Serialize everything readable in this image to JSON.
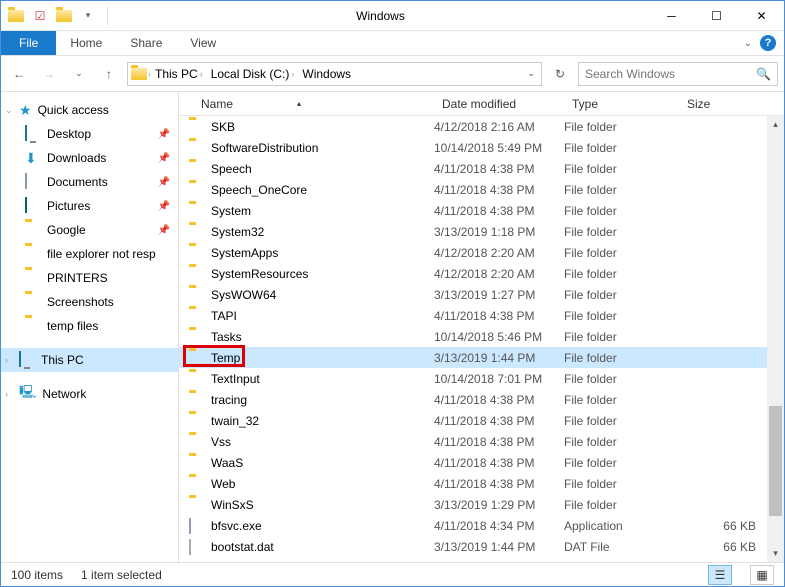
{
  "window": {
    "title": "Windows"
  },
  "ribbon": {
    "file": "File",
    "tabs": [
      "Home",
      "Share",
      "View"
    ]
  },
  "breadcrumb": {
    "segments": [
      "This PC",
      "Local Disk (C:)",
      "Windows"
    ]
  },
  "search": {
    "placeholder": "Search Windows"
  },
  "sidebar": {
    "quick_access": "Quick access",
    "items": [
      {
        "label": "Desktop",
        "icon": "desktop",
        "pinned": true
      },
      {
        "label": "Downloads",
        "icon": "downloads",
        "pinned": true
      },
      {
        "label": "Documents",
        "icon": "documents",
        "pinned": true
      },
      {
        "label": "Pictures",
        "icon": "pictures",
        "pinned": true
      },
      {
        "label": "Google",
        "icon": "folder",
        "pinned": true
      },
      {
        "label": "file explorer not resp",
        "icon": "folder",
        "pinned": false
      },
      {
        "label": "PRINTERS",
        "icon": "folder",
        "pinned": false
      },
      {
        "label": "Screenshots",
        "icon": "folder",
        "pinned": false
      },
      {
        "label": "temp files",
        "icon": "folder",
        "pinned": false
      }
    ],
    "this_pc": "This PC",
    "network": "Network"
  },
  "columns": {
    "name": "Name",
    "date": "Date modified",
    "type": "Type",
    "size": "Size"
  },
  "files": [
    {
      "name": "SKB",
      "date": "4/12/2018 2:16 AM",
      "type": "File folder",
      "icon": "folder",
      "size": ""
    },
    {
      "name": "SoftwareDistribution",
      "date": "10/14/2018 5:49 PM",
      "type": "File folder",
      "icon": "folder",
      "size": ""
    },
    {
      "name": "Speech",
      "date": "4/11/2018 4:38 PM",
      "type": "File folder",
      "icon": "folder",
      "size": ""
    },
    {
      "name": "Speech_OneCore",
      "date": "4/11/2018 4:38 PM",
      "type": "File folder",
      "icon": "folder",
      "size": ""
    },
    {
      "name": "System",
      "date": "4/11/2018 4:38 PM",
      "type": "File folder",
      "icon": "folder",
      "size": ""
    },
    {
      "name": "System32",
      "date": "3/13/2019 1:18 PM",
      "type": "File folder",
      "icon": "folder",
      "size": ""
    },
    {
      "name": "SystemApps",
      "date": "4/12/2018 2:20 AM",
      "type": "File folder",
      "icon": "folder",
      "size": ""
    },
    {
      "name": "SystemResources",
      "date": "4/12/2018 2:20 AM",
      "type": "File folder",
      "icon": "folder",
      "size": ""
    },
    {
      "name": "SysWOW64",
      "date": "3/13/2019 1:27 PM",
      "type": "File folder",
      "icon": "folder",
      "size": ""
    },
    {
      "name": "TAPI",
      "date": "4/11/2018 4:38 PM",
      "type": "File folder",
      "icon": "folder",
      "size": ""
    },
    {
      "name": "Tasks",
      "date": "10/14/2018 5:46 PM",
      "type": "File folder",
      "icon": "folder",
      "size": ""
    },
    {
      "name": "Temp",
      "date": "3/13/2019 1:44 PM",
      "type": "File folder",
      "icon": "folder",
      "size": "",
      "selected": true,
      "highlighted": true
    },
    {
      "name": "TextInput",
      "date": "10/14/2018 7:01 PM",
      "type": "File folder",
      "icon": "folder",
      "size": ""
    },
    {
      "name": "tracing",
      "date": "4/11/2018 4:38 PM",
      "type": "File folder",
      "icon": "folder",
      "size": ""
    },
    {
      "name": "twain_32",
      "date": "4/11/2018 4:38 PM",
      "type": "File folder",
      "icon": "folder",
      "size": ""
    },
    {
      "name": "Vss",
      "date": "4/11/2018 4:38 PM",
      "type": "File folder",
      "icon": "folder",
      "size": ""
    },
    {
      "name": "WaaS",
      "date": "4/11/2018 4:38 PM",
      "type": "File folder",
      "icon": "folder",
      "size": ""
    },
    {
      "name": "Web",
      "date": "4/11/2018 4:38 PM",
      "type": "File folder",
      "icon": "folder",
      "size": ""
    },
    {
      "name": "WinSxS",
      "date": "3/13/2019 1:29 PM",
      "type": "File folder",
      "icon": "folder",
      "size": ""
    },
    {
      "name": "bfsvc.exe",
      "date": "4/11/2018 4:34 PM",
      "type": "Application",
      "icon": "exe",
      "size": "66 KB"
    },
    {
      "name": "bootstat.dat",
      "date": "3/13/2019 1:44 PM",
      "type": "DAT File",
      "icon": "file",
      "size": "66 KB"
    }
  ],
  "status": {
    "count": "100 items",
    "selection": "1 item selected"
  }
}
